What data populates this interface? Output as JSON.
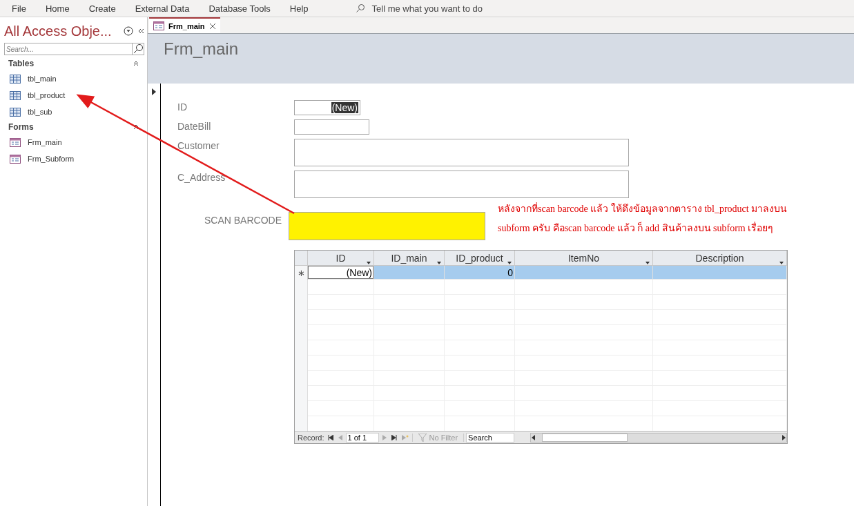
{
  "menu": {
    "items": [
      "File",
      "Home",
      "Create",
      "External Data",
      "Database Tools",
      "Help"
    ],
    "tell_me": "Tell me what you want to do"
  },
  "nav_pane": {
    "title": "All Access Obje...",
    "search": {
      "placeholder": "Search..."
    },
    "groups": [
      {
        "name": "Tables",
        "kind": "table",
        "expanded": true,
        "items": [
          "tbl_main",
          "tbl_product",
          "tbl_sub"
        ]
      },
      {
        "name": "Forms",
        "kind": "form",
        "expanded": true,
        "items": [
          "Frm_main",
          "Frm_Subform"
        ]
      }
    ]
  },
  "tabs": [
    {
      "label": "Frm_main",
      "selected": true
    }
  ],
  "form": {
    "title": "Frm_main",
    "fields": [
      {
        "label": "ID",
        "value": "(New)",
        "kind": "short",
        "focused": true
      },
      {
        "label": "DateBill",
        "kind": "medium"
      },
      {
        "label": "Customer",
        "kind": "wide"
      },
      {
        "label": "C_Address",
        "kind": "wide"
      }
    ],
    "scan": {
      "label": "SCAN BARCODE"
    },
    "annotation": {
      "lines": [
        "หลังจากที่scan barcode แล้ว  ให้ดึงข้อมูลจากตาราง tbl_product มาลงบน",
        "subform ครับ คือscan barcode แล้ว ก็ add สินค้าลงบน subform เรื่อยๆ"
      ]
    },
    "subform": {
      "columns": [
        "ID",
        "ID_main",
        "ID_product",
        "ItemNo",
        "Description"
      ],
      "rows": [
        {
          "marker": "∗",
          "selected": true,
          "cells": [
            {
              "text": "(New)",
              "current": true
            },
            {
              "current": false
            },
            {
              "text": "0",
              "current": false
            },
            {
              "current": false
            },
            {
              "current": false
            }
          ]
        }
      ],
      "nav": {
        "label": "Record:",
        "position": "1 of 1",
        "filter": "No Filter",
        "search": "Search"
      }
    }
  }
}
